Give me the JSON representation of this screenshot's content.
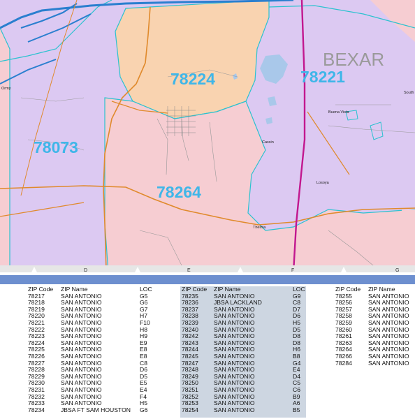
{
  "map": {
    "county_label": "BEXAR",
    "zip_labels": [
      "78224",
      "78221",
      "78073",
      "78264"
    ],
    "place_labels": [
      "Ormy",
      "Buena Vista",
      "Cassin",
      "Losoya",
      "Thelma",
      "South"
    ],
    "grid_letters": [
      "D",
      "E",
      "F",
      "G"
    ],
    "colors": {
      "lavender": "#dcc9f2",
      "peach": "#f9d3b0",
      "pink": "#f6cdd2",
      "zip_border": "#2bc2cf",
      "zip_label": "#3fb6e8",
      "highway": "#e08a2c",
      "interstate": "#c2188f",
      "water": "#a9c8ea",
      "grid_bar": "#6d8fcf"
    }
  },
  "index": {
    "headers": {
      "code": "ZIP Code",
      "name": "ZIP Name",
      "loc": "LOC"
    },
    "columns": [
      {
        "rows": [
          {
            "code": "78217",
            "name": "SAN ANTONIO",
            "loc": "G5"
          },
          {
            "code": "78218",
            "name": "SAN ANTONIO",
            "loc": "G6"
          },
          {
            "code": "78219",
            "name": "SAN ANTONIO",
            "loc": "G7"
          },
          {
            "code": "78220",
            "name": "SAN ANTONIO",
            "loc": "H7"
          },
          {
            "code": "78221",
            "name": "SAN ANTONIO",
            "loc": "F10"
          },
          {
            "code": "78222",
            "name": "SAN ANTONIO",
            "loc": "H8"
          },
          {
            "code": "78223",
            "name": "SAN ANTONIO",
            "loc": "H9"
          },
          {
            "code": "78224",
            "name": "SAN ANTONIO",
            "loc": "E9"
          },
          {
            "code": "78225",
            "name": "SAN ANTONIO",
            "loc": "E8"
          },
          {
            "code": "78226",
            "name": "SAN ANTONIO",
            "loc": "E8"
          },
          {
            "code": "78227",
            "name": "SAN ANTONIO",
            "loc": "C8"
          },
          {
            "code": "78228",
            "name": "SAN ANTONIO",
            "loc": "D6"
          },
          {
            "code": "78229",
            "name": "SAN ANTONIO",
            "loc": "D5"
          },
          {
            "code": "78230",
            "name": "SAN ANTONIO",
            "loc": "E5"
          },
          {
            "code": "78231",
            "name": "SAN ANTONIO",
            "loc": "E4"
          },
          {
            "code": "78232",
            "name": "SAN ANTONIO",
            "loc": "F4"
          },
          {
            "code": "78233",
            "name": "SAN ANTONIO",
            "loc": "H5"
          },
          {
            "code": "78234",
            "name": "JBSA FT SAM HOUSTON",
            "loc": "G6"
          }
        ]
      },
      {
        "rows": [
          {
            "code": "78235",
            "name": "SAN ANTONIO",
            "loc": "G9"
          },
          {
            "code": "78236",
            "name": "JBSA LACKLAND",
            "loc": "C8"
          },
          {
            "code": "78237",
            "name": "SAN ANTONIO",
            "loc": "D7"
          },
          {
            "code": "78238",
            "name": "SAN ANTONIO",
            "loc": "D6"
          },
          {
            "code": "78239",
            "name": "SAN ANTONIO",
            "loc": "H5"
          },
          {
            "code": "78240",
            "name": "SAN ANTONIO",
            "loc": "D5"
          },
          {
            "code": "78242",
            "name": "SAN ANTONIO",
            "loc": "D8"
          },
          {
            "code": "78243",
            "name": "SAN ANTONIO",
            "loc": "D8"
          },
          {
            "code": "78244",
            "name": "SAN ANTONIO",
            "loc": "H6"
          },
          {
            "code": "78245",
            "name": "SAN ANTONIO",
            "loc": "B8"
          },
          {
            "code": "78247",
            "name": "SAN ANTONIO",
            "loc": "G4"
          },
          {
            "code": "78248",
            "name": "SAN ANTONIO",
            "loc": "E4"
          },
          {
            "code": "78249",
            "name": "SAN ANTONIO",
            "loc": "D4"
          },
          {
            "code": "78250",
            "name": "SAN ANTONIO",
            "loc": "C5"
          },
          {
            "code": "78251",
            "name": "SAN ANTONIO",
            "loc": "C6"
          },
          {
            "code": "78252",
            "name": "SAN ANTONIO",
            "loc": "B9"
          },
          {
            "code": "78253",
            "name": "SAN ANTONIO",
            "loc": "A6"
          },
          {
            "code": "78254",
            "name": "SAN ANTONIO",
            "loc": "B5"
          }
        ]
      },
      {
        "rows": [
          {
            "code": "78255",
            "name": "SAN ANTONIO"
          },
          {
            "code": "78256",
            "name": "SAN ANTONIO"
          },
          {
            "code": "78257",
            "name": "SAN ANTONIO"
          },
          {
            "code": "78258",
            "name": "SAN ANTONIO"
          },
          {
            "code": "78259",
            "name": "SAN ANTONIO"
          },
          {
            "code": "78260",
            "name": "SAN ANTONIO"
          },
          {
            "code": "78261",
            "name": "SAN ANTONIO"
          },
          {
            "code": "78263",
            "name": "SAN ANTONIO"
          },
          {
            "code": "78264",
            "name": "SAN ANTONIO"
          },
          {
            "code": "78266",
            "name": "SAN ANTONIO"
          },
          {
            "code": "78284",
            "name": "SAN ANTONIO"
          }
        ]
      }
    ]
  }
}
